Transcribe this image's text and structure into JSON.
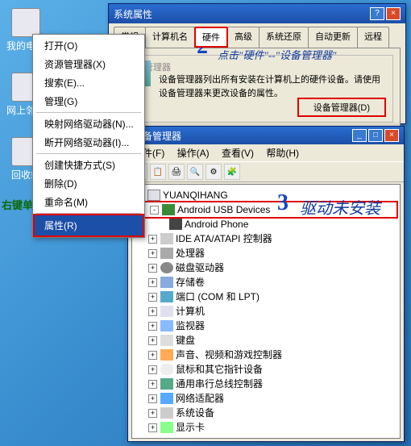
{
  "desktop": {
    "icons": [
      {
        "label": "我的电脑"
      },
      {
        "label": "网上邻居"
      },
      {
        "label": "回收站"
      }
    ]
  },
  "sysprop": {
    "title": "系统属性",
    "tabs": [
      "常规",
      "计算机名",
      "硬件",
      "高级",
      "系统还原",
      "自动更新",
      "远程"
    ],
    "active_tab_index": 2,
    "panel_legend": "设备管理器",
    "panel_desc": "设备管理器列出所有安装在计算机上的硬件设备。请使用设备管理器来更改设备的属性。",
    "devmgr_button": "设备管理器(D)"
  },
  "context_menu": {
    "header": "打开(O)",
    "items_a": [
      "资源管理器(X)",
      "搜索(E)...",
      "管理(G)"
    ],
    "items_b": [
      "映射网络驱动器(N)...",
      "断开网络驱动器(I)..."
    ],
    "items_c": [
      "创建快捷方式(S)",
      "删除(D)",
      "重命名(M)"
    ],
    "properties": "属性(R)"
  },
  "devmgr": {
    "title": "设备管理器",
    "menus": [
      "文件(F)",
      "操作(A)",
      "查看(V)",
      "帮助(H)"
    ],
    "root": "YUANQIHANG",
    "android_group": "Android USB Devices",
    "android_child": "Android Phone",
    "categories": [
      "IDE ATA/ATAPI 控制器",
      "处理器",
      "磁盘驱动器",
      "存储卷",
      "端口 (COM 和 LPT)",
      "计算机",
      "监视器",
      "键盘",
      "声音、视频和游戏控制器",
      "鼠标和其它指针设备",
      "通用串行总线控制器",
      "网络适配器",
      "系统设备",
      "显示卡"
    ]
  },
  "annotations": {
    "num2": "2",
    "tip2": "点击\"硬件\"--\"设备管理器\"",
    "tip_left": "右键单击\"我的电脑-属性\"",
    "num3": "3",
    "tip3": "驱动未安装"
  }
}
